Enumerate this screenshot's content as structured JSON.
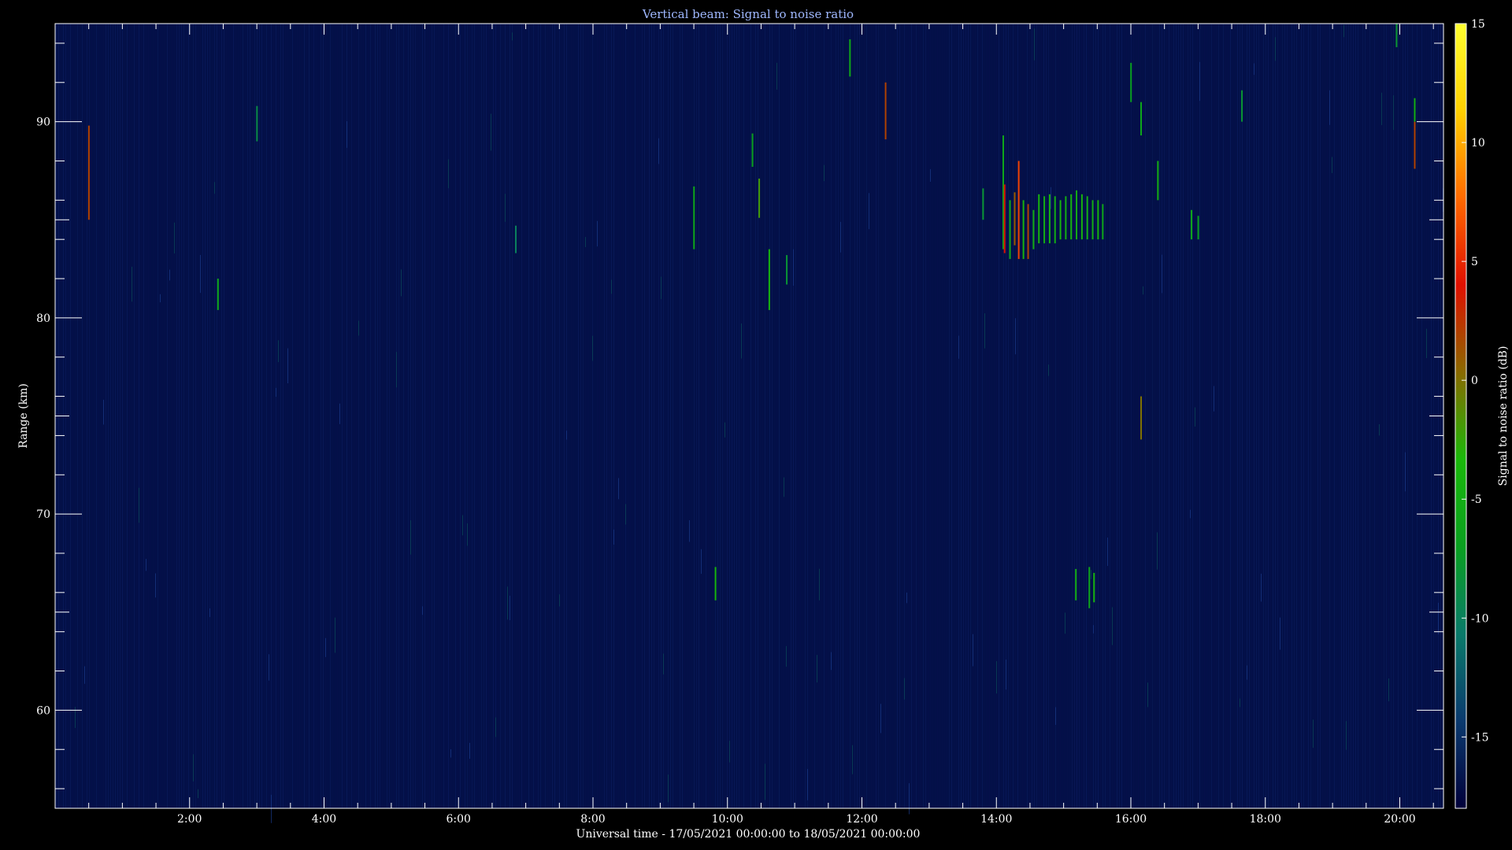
{
  "chart_data": {
    "type": "heatmap",
    "title": "Vertical beam: Signal to noise ratio",
    "xlabel": "Universal time - 17/05/2021 00:00:00 to 18/05/2021 00:00:00",
    "ylabel": "Range (km)",
    "colorbar_label": "Signal to noise ratio (dB)",
    "xlim_hours": [
      0,
      20.65
    ],
    "ylim_km": [
      55,
      95
    ],
    "x_ticks": [
      {
        "hour": 2,
        "label": "2:00"
      },
      {
        "hour": 4,
        "label": "4:00"
      },
      {
        "hour": 6,
        "label": "6:00"
      },
      {
        "hour": 8,
        "label": "8:00"
      },
      {
        "hour": 10,
        "label": "10:00"
      },
      {
        "hour": 12,
        "label": "12:00"
      },
      {
        "hour": 14,
        "label": "14:00"
      },
      {
        "hour": 16,
        "label": "16:00"
      },
      {
        "hour": 18,
        "label": "18:00"
      },
      {
        "hour": 20,
        "label": "20:00"
      }
    ],
    "y_ticks": [
      {
        "km": 60,
        "label": "60"
      },
      {
        "km": 70,
        "label": "70"
      },
      {
        "km": 80,
        "label": "80"
      },
      {
        "km": 90,
        "label": "90"
      }
    ],
    "colorbar": {
      "range_db": [
        -18,
        15
      ],
      "ticks": [
        {
          "db": 15,
          "label": "15"
        },
        {
          "db": 10,
          "label": "10"
        },
        {
          "db": 5,
          "label": "5"
        },
        {
          "db": 0,
          "label": "0"
        },
        {
          "db": -5,
          "label": "-5"
        },
        {
          "db": -10,
          "label": "-10"
        },
        {
          "db": -15,
          "label": "-15"
        }
      ],
      "stops": [
        "#00003a",
        "#0b3a6e",
        "#0a7a6a",
        "#0aa020",
        "#1ab80a",
        "#8a6a00",
        "#e01000",
        "#ff6a00",
        "#ffd000",
        "#ffff30"
      ]
    },
    "background_db": -17,
    "echoes": [
      {
        "t": 0.5,
        "r0": 85.0,
        "r1": 89.8,
        "snr": 2
      },
      {
        "t": 2.42,
        "r0": 80.4,
        "r1": 82.0,
        "snr": -6
      },
      {
        "t": 3.0,
        "r0": 89.0,
        "r1": 90.8,
        "snr": -9
      },
      {
        "t": 6.85,
        "r0": 83.3,
        "r1": 84.7,
        "snr": -10
      },
      {
        "t": 9.5,
        "r0": 83.5,
        "r1": 86.7,
        "snr": -6
      },
      {
        "t": 9.82,
        "r0": 65.6,
        "r1": 67.3,
        "snr": -4
      },
      {
        "t": 10.37,
        "r0": 87.7,
        "r1": 89.4,
        "snr": -7
      },
      {
        "t": 10.47,
        "r0": 85.1,
        "r1": 87.1,
        "snr": -2
      },
      {
        "t": 10.62,
        "r0": 80.4,
        "r1": 83.5,
        "snr": -4
      },
      {
        "t": 10.88,
        "r0": 81.7,
        "r1": 83.2,
        "snr": -8
      },
      {
        "t": 11.82,
        "r0": 92.3,
        "r1": 94.2,
        "snr": -6
      },
      {
        "t": 12.35,
        "r0": 89.1,
        "r1": 92.0,
        "snr": 2
      },
      {
        "t": 13.8,
        "r0": 85.0,
        "r1": 86.6,
        "snr": -8
      },
      {
        "t": 14.1,
        "r0": 83.5,
        "r1": 89.3,
        "snr": -6
      },
      {
        "t": 14.12,
        "r0": 83.3,
        "r1": 86.8,
        "snr": 4
      },
      {
        "t": 14.2,
        "r0": 83.0,
        "r1": 86.0,
        "snr": -5
      },
      {
        "t": 14.27,
        "r0": 83.7,
        "r1": 86.4,
        "snr": 1
      },
      {
        "t": 14.33,
        "r0": 83.0,
        "r1": 88.0,
        "snr": 6
      },
      {
        "t": 14.4,
        "r0": 83.0,
        "r1": 86.0,
        "snr": -4
      },
      {
        "t": 14.47,
        "r0": 83.0,
        "r1": 85.8,
        "snr": 2
      },
      {
        "t": 14.55,
        "r0": 83.5,
        "r1": 85.5,
        "snr": -5
      },
      {
        "t": 14.63,
        "r0": 83.8,
        "r1": 86.3,
        "snr": -4
      },
      {
        "t": 14.71,
        "r0": 83.8,
        "r1": 86.2,
        "snr": -5
      },
      {
        "t": 14.79,
        "r0": 83.8,
        "r1": 86.3,
        "snr": -4
      },
      {
        "t": 14.87,
        "r0": 83.8,
        "r1": 86.2,
        "snr": -5
      },
      {
        "t": 14.95,
        "r0": 84.0,
        "r1": 86.0,
        "snr": -4
      },
      {
        "t": 15.03,
        "r0": 84.0,
        "r1": 86.2,
        "snr": -5
      },
      {
        "t": 15.11,
        "r0": 84.0,
        "r1": 86.3,
        "snr": -4
      },
      {
        "t": 15.19,
        "r0": 84.0,
        "r1": 86.5,
        "snr": -5
      },
      {
        "t": 15.27,
        "r0": 84.0,
        "r1": 86.3,
        "snr": -4
      },
      {
        "t": 15.35,
        "r0": 84.0,
        "r1": 86.2,
        "snr": -5
      },
      {
        "t": 15.43,
        "r0": 84.0,
        "r1": 86.0,
        "snr": -5
      },
      {
        "t": 15.51,
        "r0": 84.0,
        "r1": 86.0,
        "snr": -4
      },
      {
        "t": 15.58,
        "r0": 84.0,
        "r1": 85.8,
        "snr": -6
      },
      {
        "t": 15.18,
        "r0": 65.6,
        "r1": 67.2,
        "snr": -5
      },
      {
        "t": 15.38,
        "r0": 65.2,
        "r1": 67.3,
        "snr": -6
      },
      {
        "t": 15.45,
        "r0": 65.5,
        "r1": 67.0,
        "snr": -4
      },
      {
        "t": 16.0,
        "r0": 91.0,
        "r1": 93.0,
        "snr": -7
      },
      {
        "t": 16.15,
        "r0": 89.3,
        "r1": 91.0,
        "snr": -6
      },
      {
        "t": 16.15,
        "r0": 73.8,
        "r1": 76.0,
        "snr": 0
      },
      {
        "t": 16.4,
        "r0": 86.0,
        "r1": 88.0,
        "snr": -5
      },
      {
        "t": 16.9,
        "r0": 84.0,
        "r1": 85.5,
        "snr": -6
      },
      {
        "t": 17.0,
        "r0": 84.0,
        "r1": 85.2,
        "snr": -7
      },
      {
        "t": 17.65,
        "r0": 90.0,
        "r1": 91.6,
        "snr": -8
      },
      {
        "t": 19.95,
        "r0": 93.8,
        "r1": 95.0,
        "snr": -8
      },
      {
        "t": 20.22,
        "r0": 87.6,
        "r1": 90.0,
        "snr": 2
      },
      {
        "t": 20.22,
        "r0": 90.0,
        "r1": 91.2,
        "snr": -5
      }
    ]
  }
}
